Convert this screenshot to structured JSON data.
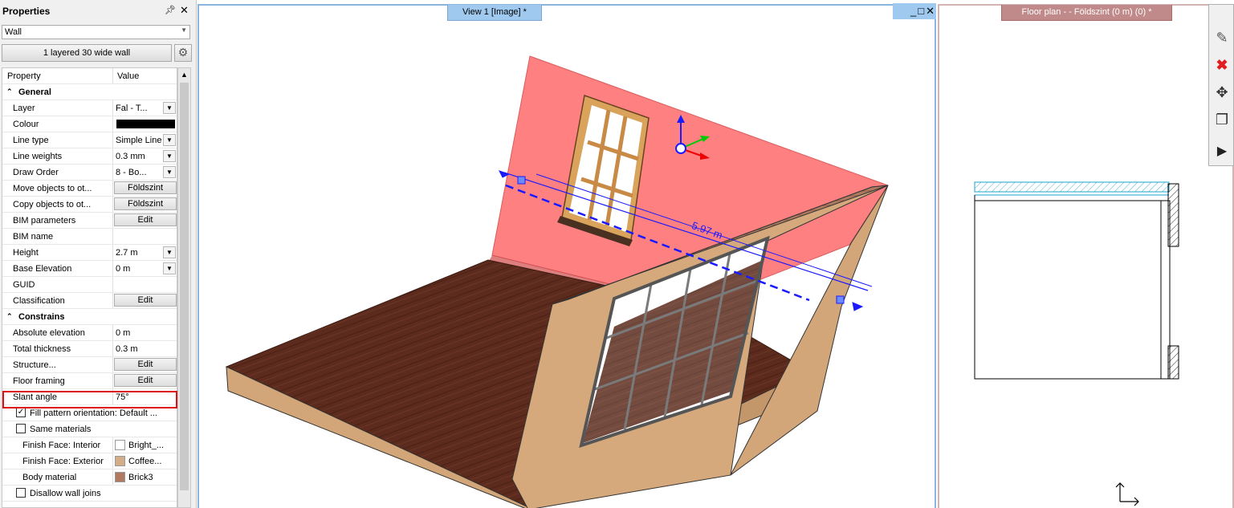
{
  "properties": {
    "title": "Properties",
    "pin_icon": "pin-icon",
    "close_glyph": "✕",
    "type_selector": "Wall",
    "wall_type_button": "1 layered 30 wide wall",
    "header": {
      "property": "Property",
      "value": "Value"
    },
    "rows": [
      {
        "kind": "cat",
        "label": "General"
      },
      {
        "kind": "dd",
        "label": "Layer",
        "value": "Fal - T..."
      },
      {
        "kind": "swatch",
        "label": "Colour",
        "color": "#000000"
      },
      {
        "kind": "dd",
        "label": "Line type",
        "value": "Simple Line"
      },
      {
        "kind": "dd",
        "label": "Line weights",
        "value": "0.3 mm"
      },
      {
        "kind": "dd",
        "label": "Draw Order",
        "value": "8 - Bo..."
      },
      {
        "kind": "btn",
        "label": "Move objects to ot...",
        "value": "Földszint"
      },
      {
        "kind": "btn",
        "label": "Copy objects to ot...",
        "value": "Földszint"
      },
      {
        "kind": "btn",
        "label": "BIM parameters",
        "value": "Edit"
      },
      {
        "kind": "text",
        "label": "BIM name",
        "value": ""
      },
      {
        "kind": "dd",
        "label": "Height",
        "value": "2.7 m"
      },
      {
        "kind": "dd",
        "label": "Base Elevation",
        "value": "0 m"
      },
      {
        "kind": "text",
        "label": "GUID",
        "value": ""
      },
      {
        "kind": "btn",
        "label": "Classification",
        "value": "Edit"
      },
      {
        "kind": "cat",
        "label": "Constrains"
      },
      {
        "kind": "text",
        "label": "Absolute elevation",
        "value": "0 m"
      },
      {
        "kind": "text",
        "label": "Total thickness",
        "value": "0.3 m"
      },
      {
        "kind": "btn",
        "label": "Structure...",
        "value": "Edit"
      },
      {
        "kind": "btn",
        "label": "Floor framing",
        "value": "Edit"
      },
      {
        "kind": "text",
        "label": "Slant angle",
        "value": "75°"
      },
      {
        "kind": "chk",
        "label": "Fill pattern orientation: Default ...",
        "checked": true
      },
      {
        "kind": "chk",
        "label": "Same materials",
        "checked": false
      },
      {
        "kind": "mat",
        "label": "Finish Face: Interior",
        "value": "Bright_...",
        "color": "#ffffff"
      },
      {
        "kind": "mat",
        "label": "Finish Face: Exterior",
        "value": "Coffee...",
        "color": "#d2ad88"
      },
      {
        "kind": "mat",
        "label": "Body material",
        "value": "Brick3",
        "color": "#b07a60"
      },
      {
        "kind": "chk",
        "label": "Disallow wall joins",
        "checked": false
      }
    ]
  },
  "views": {
    "view1_tab": "View 1 [Image] *",
    "floorplan_tab": "Floor plan -  - Földszint (0 m) (0) *",
    "dimension_label": "5.97 m"
  },
  "toolbar": {
    "tools": [
      "pencil-icon",
      "delete-icon",
      "move-icon",
      "copy-icon",
      "expand-arrow-icon"
    ]
  },
  "colors": {
    "wall_pink": "#ff8080",
    "floor_wood": "#5a2a1c",
    "dormer_tan": "#d2a679",
    "accent_blue": "#1a1aff",
    "view_tab_blue": "#9fc9ee",
    "plan_tab_red": "#c18a8a"
  }
}
